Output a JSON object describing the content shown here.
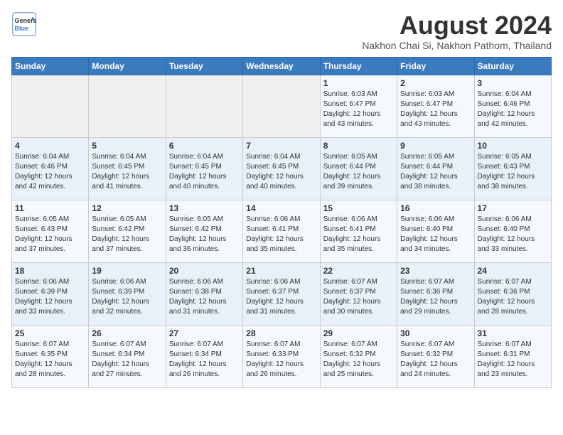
{
  "logo": {
    "text_general": "General",
    "text_blue": "Blue"
  },
  "header": {
    "title": "August 2024",
    "subtitle": "Nakhon Chai Si, Nakhon Pathom, Thailand"
  },
  "weekdays": [
    "Sunday",
    "Monday",
    "Tuesday",
    "Wednesday",
    "Thursday",
    "Friday",
    "Saturday"
  ],
  "weeks": [
    [
      {
        "day": "",
        "sunrise": "",
        "sunset": "",
        "daylight": ""
      },
      {
        "day": "",
        "sunrise": "",
        "sunset": "",
        "daylight": ""
      },
      {
        "day": "",
        "sunrise": "",
        "sunset": "",
        "daylight": ""
      },
      {
        "day": "",
        "sunrise": "",
        "sunset": "",
        "daylight": ""
      },
      {
        "day": "1",
        "sunrise": "Sunrise: 6:03 AM",
        "sunset": "Sunset: 6:47 PM",
        "daylight": "Daylight: 12 hours and 43 minutes."
      },
      {
        "day": "2",
        "sunrise": "Sunrise: 6:03 AM",
        "sunset": "Sunset: 6:47 PM",
        "daylight": "Daylight: 12 hours and 43 minutes."
      },
      {
        "day": "3",
        "sunrise": "Sunrise: 6:04 AM",
        "sunset": "Sunset: 6:46 PM",
        "daylight": "Daylight: 12 hours and 42 minutes."
      }
    ],
    [
      {
        "day": "4",
        "sunrise": "Sunrise: 6:04 AM",
        "sunset": "Sunset: 6:46 PM",
        "daylight": "Daylight: 12 hours and 42 minutes."
      },
      {
        "day": "5",
        "sunrise": "Sunrise: 6:04 AM",
        "sunset": "Sunset: 6:45 PM",
        "daylight": "Daylight: 12 hours and 41 minutes."
      },
      {
        "day": "6",
        "sunrise": "Sunrise: 6:04 AM",
        "sunset": "Sunset: 6:45 PM",
        "daylight": "Daylight: 12 hours and 40 minutes."
      },
      {
        "day": "7",
        "sunrise": "Sunrise: 6:04 AM",
        "sunset": "Sunset: 6:45 PM",
        "daylight": "Daylight: 12 hours and 40 minutes."
      },
      {
        "day": "8",
        "sunrise": "Sunrise: 6:05 AM",
        "sunset": "Sunset: 6:44 PM",
        "daylight": "Daylight: 12 hours and 39 minutes."
      },
      {
        "day": "9",
        "sunrise": "Sunrise: 6:05 AM",
        "sunset": "Sunset: 6:44 PM",
        "daylight": "Daylight: 12 hours and 38 minutes."
      },
      {
        "day": "10",
        "sunrise": "Sunrise: 6:05 AM",
        "sunset": "Sunset: 6:43 PM",
        "daylight": "Daylight: 12 hours and 38 minutes."
      }
    ],
    [
      {
        "day": "11",
        "sunrise": "Sunrise: 6:05 AM",
        "sunset": "Sunset: 6:43 PM",
        "daylight": "Daylight: 12 hours and 37 minutes."
      },
      {
        "day": "12",
        "sunrise": "Sunrise: 6:05 AM",
        "sunset": "Sunset: 6:42 PM",
        "daylight": "Daylight: 12 hours and 37 minutes."
      },
      {
        "day": "13",
        "sunrise": "Sunrise: 6:05 AM",
        "sunset": "Sunset: 6:42 PM",
        "daylight": "Daylight: 12 hours and 36 minutes."
      },
      {
        "day": "14",
        "sunrise": "Sunrise: 6:06 AM",
        "sunset": "Sunset: 6:41 PM",
        "daylight": "Daylight: 12 hours and 35 minutes."
      },
      {
        "day": "15",
        "sunrise": "Sunrise: 6:06 AM",
        "sunset": "Sunset: 6:41 PM",
        "daylight": "Daylight: 12 hours and 35 minutes."
      },
      {
        "day": "16",
        "sunrise": "Sunrise: 6:06 AM",
        "sunset": "Sunset: 6:40 PM",
        "daylight": "Daylight: 12 hours and 34 minutes."
      },
      {
        "day": "17",
        "sunrise": "Sunrise: 6:06 AM",
        "sunset": "Sunset: 6:40 PM",
        "daylight": "Daylight: 12 hours and 33 minutes."
      }
    ],
    [
      {
        "day": "18",
        "sunrise": "Sunrise: 6:06 AM",
        "sunset": "Sunset: 6:39 PM",
        "daylight": "Daylight: 12 hours and 33 minutes."
      },
      {
        "day": "19",
        "sunrise": "Sunrise: 6:06 AM",
        "sunset": "Sunset: 6:39 PM",
        "daylight": "Daylight: 12 hours and 32 minutes."
      },
      {
        "day": "20",
        "sunrise": "Sunrise: 6:06 AM",
        "sunset": "Sunset: 6:38 PM",
        "daylight": "Daylight: 12 hours and 31 minutes."
      },
      {
        "day": "21",
        "sunrise": "Sunrise: 6:06 AM",
        "sunset": "Sunset: 6:37 PM",
        "daylight": "Daylight: 12 hours and 31 minutes."
      },
      {
        "day": "22",
        "sunrise": "Sunrise: 6:07 AM",
        "sunset": "Sunset: 6:37 PM",
        "daylight": "Daylight: 12 hours and 30 minutes."
      },
      {
        "day": "23",
        "sunrise": "Sunrise: 6:07 AM",
        "sunset": "Sunset: 6:36 PM",
        "daylight": "Daylight: 12 hours and 29 minutes."
      },
      {
        "day": "24",
        "sunrise": "Sunrise: 6:07 AM",
        "sunset": "Sunset: 6:36 PM",
        "daylight": "Daylight: 12 hours and 28 minutes."
      }
    ],
    [
      {
        "day": "25",
        "sunrise": "Sunrise: 6:07 AM",
        "sunset": "Sunset: 6:35 PM",
        "daylight": "Daylight: 12 hours and 28 minutes."
      },
      {
        "day": "26",
        "sunrise": "Sunrise: 6:07 AM",
        "sunset": "Sunset: 6:34 PM",
        "daylight": "Daylight: 12 hours and 27 minutes."
      },
      {
        "day": "27",
        "sunrise": "Sunrise: 6:07 AM",
        "sunset": "Sunset: 6:34 PM",
        "daylight": "Daylight: 12 hours and 26 minutes."
      },
      {
        "day": "28",
        "sunrise": "Sunrise: 6:07 AM",
        "sunset": "Sunset: 6:33 PM",
        "daylight": "Daylight: 12 hours and 26 minutes."
      },
      {
        "day": "29",
        "sunrise": "Sunrise: 6:07 AM",
        "sunset": "Sunset: 6:32 PM",
        "daylight": "Daylight: 12 hours and 25 minutes."
      },
      {
        "day": "30",
        "sunrise": "Sunrise: 6:07 AM",
        "sunset": "Sunset: 6:32 PM",
        "daylight": "Daylight: 12 hours and 24 minutes."
      },
      {
        "day": "31",
        "sunrise": "Sunrise: 6:07 AM",
        "sunset": "Sunset: 6:31 PM",
        "daylight": "Daylight: 12 hours and 23 minutes."
      }
    ]
  ]
}
